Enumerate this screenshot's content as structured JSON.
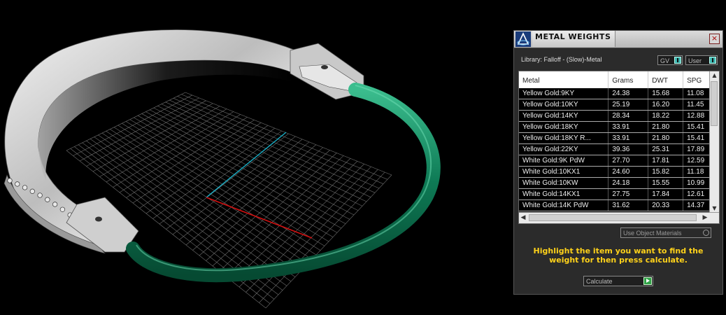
{
  "panel": {
    "title": "METAL WEIGHTS",
    "close_glyph": "×",
    "library_text": "Library: Falloff - (Slow)-Metal",
    "dropdown_gv": "GV",
    "dropdown_user": "User",
    "use_object_materials": "Use Object Materials",
    "hint": "Highlight the item you want to find the weight for then press calculate.",
    "calculate_label": "Calculate",
    "accent_color": "#ffd21a"
  },
  "table": {
    "headers": [
      "Metal",
      "Grams",
      "DWT",
      "SPG"
    ],
    "rows": [
      [
        "Yellow Gold:9KY",
        "24.38",
        "15.68",
        "11.08"
      ],
      [
        "Yellow Gold:10KY",
        "25.19",
        "16.20",
        "11.45"
      ],
      [
        "Yellow Gold:14KY",
        "28.34",
        "18.22",
        "12.88"
      ],
      [
        "Yellow Gold:18KY",
        "33.91",
        "21.80",
        "15.41"
      ],
      [
        "Yellow Gold:18KY R...",
        "33.91",
        "21.80",
        "15.41"
      ],
      [
        "Yellow Gold:22KY",
        "39.36",
        "25.31",
        "17.89"
      ],
      [
        "White Gold:9K PdW",
        "27.70",
        "17.81",
        "12.59"
      ],
      [
        "White Gold:10KX1",
        "24.60",
        "15.82",
        "11.18"
      ],
      [
        "White Gold:10KW",
        "24.18",
        "15.55",
        "10.99"
      ],
      [
        "White Gold:14KX1",
        "27.75",
        "17.84",
        "12.61"
      ],
      [
        "White Gold:14K PdW",
        "31.62",
        "20.33",
        "14.37"
      ]
    ]
  },
  "viewport": {
    "axis_x_color": "#d01010",
    "axis_y_color": "#18b0c8",
    "tube_color": "#0e7a55"
  }
}
